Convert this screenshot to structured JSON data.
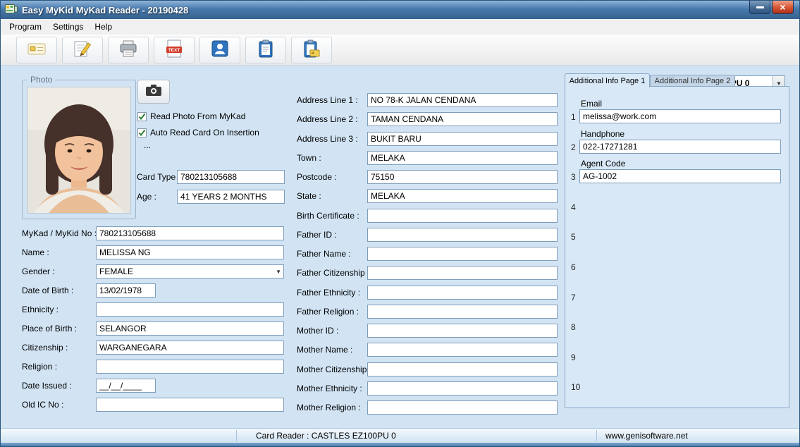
{
  "window": {
    "title": "Easy MyKid MyKad Reader - 20190428",
    "close_glyph": "×"
  },
  "menu": {
    "items": [
      "Program",
      "Settings",
      "Help"
    ]
  },
  "toolbar": {
    "icons": [
      "smartcard-icon",
      "note-edit-icon",
      "printer-icon",
      "text-document-icon",
      "user-save-icon",
      "clipboard-icon",
      "clipboard-card-icon",
      "refresh-icon"
    ],
    "device_combo": {
      "value": "CASTLES EZ100PU 0"
    }
  },
  "photo_panel": {
    "group_label": "Photo",
    "checkboxes": [
      {
        "label": "Read Photo From MyKad",
        "checked": true
      },
      {
        "label": "Auto Read Card On Insertion",
        "checked": true
      }
    ],
    "dots": "...",
    "card_type": {
      "label": "Card Type :",
      "value": "780213105688"
    },
    "age": {
      "label": "Age :",
      "value": "41 YEARS 2 MONTHS"
    }
  },
  "left_fields": [
    {
      "label": "MyKad / MyKid No :",
      "value": "780213105688"
    },
    {
      "label": "Name :",
      "value": "MELISSA NG"
    },
    {
      "label": "Gender :",
      "value": "FEMALE",
      "type": "select"
    },
    {
      "label": "Date of Birth :",
      "value": "13/02/1978",
      "type": "short"
    },
    {
      "label": "Ethnicity :",
      "value": ""
    },
    {
      "label": "Place of Birth :",
      "value": "SELANGOR"
    },
    {
      "label": "Citizenship :",
      "value": "WARGANEGARA"
    },
    {
      "label": "Religion :",
      "value": ""
    },
    {
      "label": "Date Issued :",
      "value": "__/__/____",
      "type": "short"
    },
    {
      "label": "Old IC No :",
      "value": ""
    }
  ],
  "middle_fields": [
    {
      "label": "Address Line 1 :",
      "value": "NO 78-K JALAN CENDANA"
    },
    {
      "label": "Address Line 2 :",
      "value": "TAMAN CENDANA"
    },
    {
      "label": "Address Line 3 :",
      "value": "BUKIT BARU"
    },
    {
      "label": "Town :",
      "value": "MELAKA"
    },
    {
      "label": "Postcode :",
      "value": "75150"
    },
    {
      "label": "State :",
      "value": "MELAKA"
    },
    {
      "label": "Birth Certificate :",
      "value": ""
    },
    {
      "label": "Father ID :",
      "value": ""
    },
    {
      "label": "Father Name :",
      "value": ""
    },
    {
      "label": "Father Citizenship :",
      "value": ""
    },
    {
      "label": "Father Ethnicity :",
      "value": ""
    },
    {
      "label": "Father Religion :",
      "value": ""
    },
    {
      "label": "Mother ID :",
      "value": ""
    },
    {
      "label": "Mother Name :",
      "value": ""
    },
    {
      "label": "Mother Citizenship :",
      "value": ""
    },
    {
      "label": "Mother Ethnicity :",
      "value": ""
    },
    {
      "label": "Mother Religion :",
      "value": ""
    }
  ],
  "additional_info": {
    "tabs": [
      {
        "label": "Additional Info Page 1",
        "active": true
      },
      {
        "label": "Additional Info Page 2",
        "active": false
      }
    ],
    "rows": [
      {
        "num": "1",
        "label": "Email",
        "value": "melissa@work.com"
      },
      {
        "num": "2",
        "label": "Handphone",
        "value": "022-17271281"
      },
      {
        "num": "3",
        "label": "Agent Code",
        "value": "AG-1002"
      },
      {
        "num": "4"
      },
      {
        "num": "5"
      },
      {
        "num": "6"
      },
      {
        "num": "7"
      },
      {
        "num": "8"
      },
      {
        "num": "9"
      },
      {
        "num": "10"
      }
    ]
  },
  "statusbar": {
    "reader_text": "Card Reader : CASTLES EZ100PU 0",
    "website": "www.genisoftware.net"
  },
  "colors": {
    "titlebar_blue": "#3f6fa5",
    "main_bg": "#d2e4f4",
    "accent_blue": "#1693e0"
  }
}
